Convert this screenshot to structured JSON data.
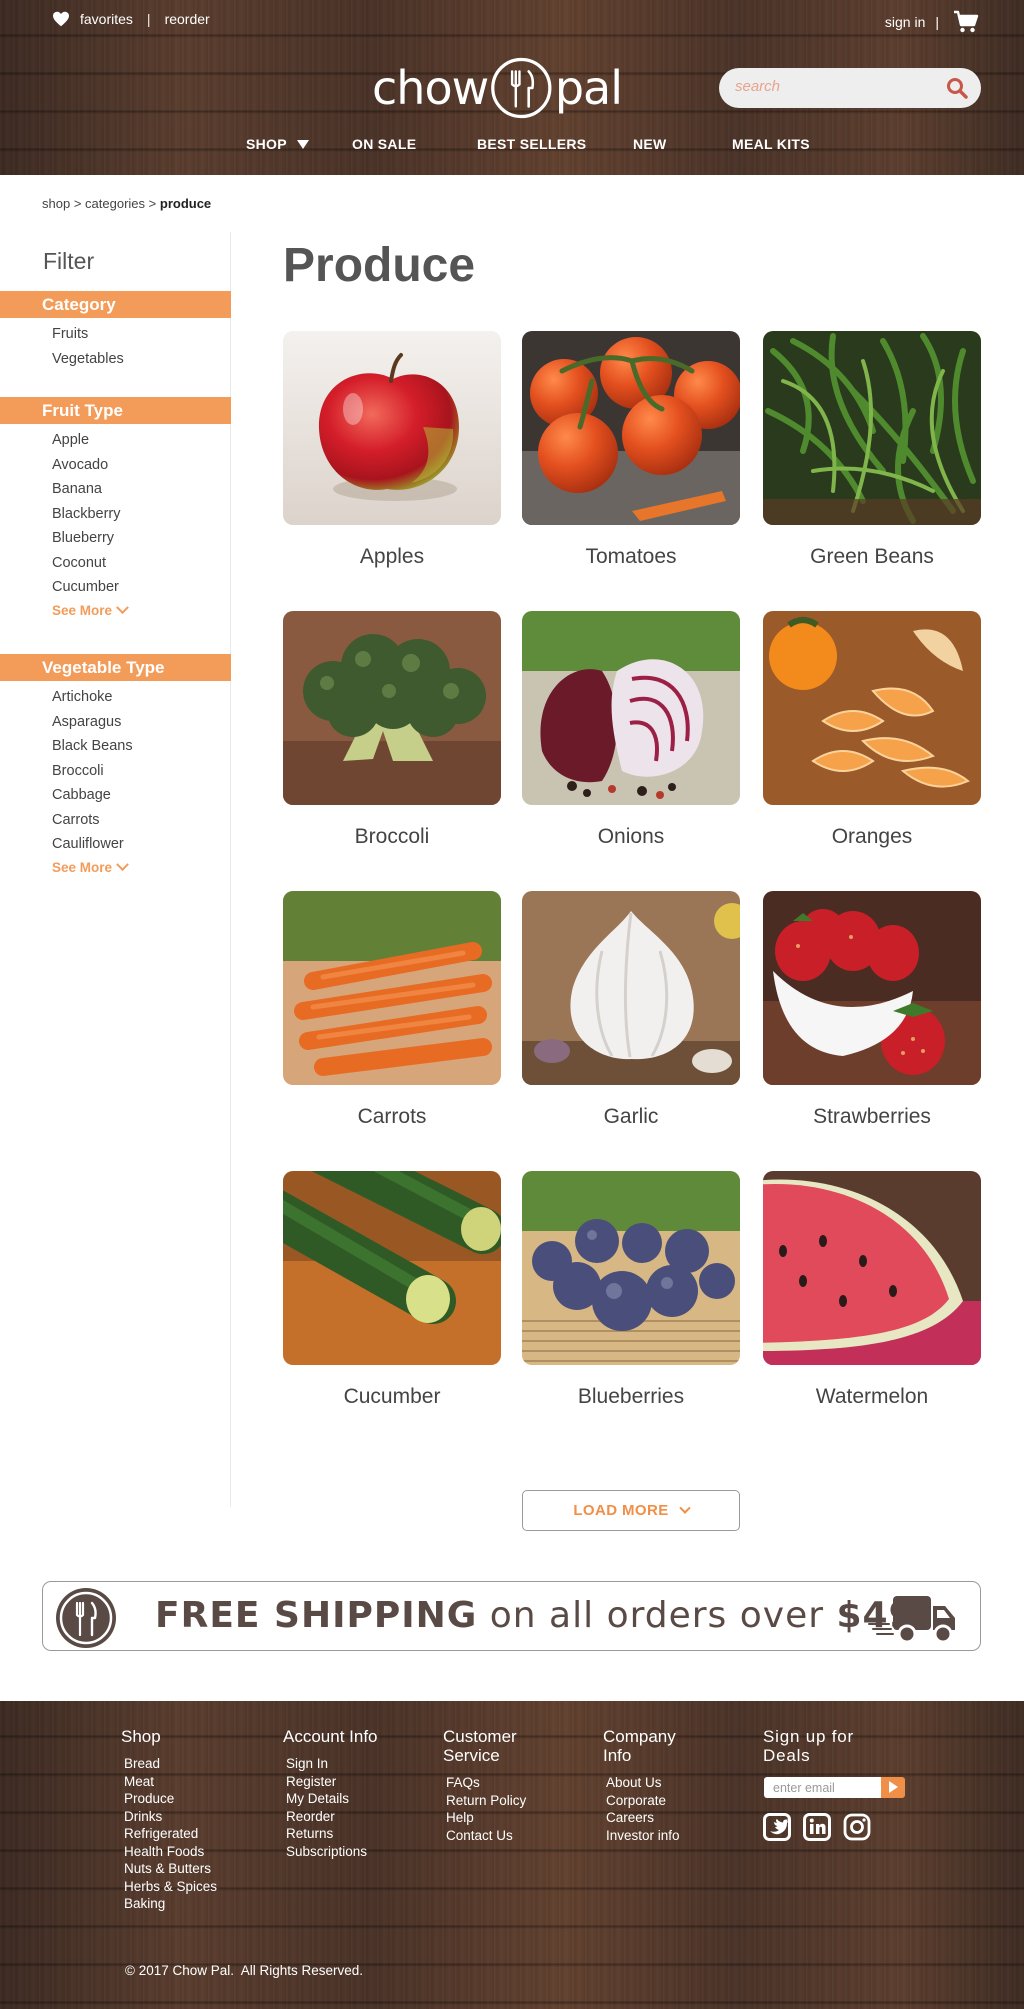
{
  "header": {
    "favorites": "favorites",
    "reorder": "reorder",
    "sign_in": "sign in",
    "logo_left": "chow",
    "logo_right": "pal",
    "search_placeholder": "search",
    "nav": [
      "SHOP",
      "ON SALE",
      "BEST SELLERS",
      "NEW",
      "MEAL KITS"
    ]
  },
  "breadcrumb": {
    "shop": "shop",
    "sep1": ">",
    "categories": "categories",
    "sep2": ">",
    "current": "produce"
  },
  "sidebar": {
    "title": "Filter",
    "category": {
      "heading": "Category",
      "items": [
        "Fruits",
        "Vegetables"
      ]
    },
    "fruit_type": {
      "heading": "Fruit Type",
      "items": [
        "Apple",
        "Avocado",
        "Banana",
        "Blackberry",
        "Blueberry",
        "Coconut",
        "Cucumber"
      ],
      "see_more": "See More"
    },
    "vegetable_type": {
      "heading": "Vegetable Type",
      "items": [
        "Artichoke",
        "Asparagus",
        "Black Beans",
        "Broccoli",
        "Cabbage",
        "Carrots",
        "Cauliflower"
      ],
      "see_more": "See More"
    }
  },
  "main": {
    "title": "Produce",
    "products": [
      "Apples",
      "Tomatoes",
      "Green Beans",
      "Broccoli",
      "Onions",
      "Oranges",
      "Carrots",
      "Garlic",
      "Strawberries",
      "Cucumber",
      "Blueberries",
      "Watermelon"
    ],
    "load_more": "LOAD MORE"
  },
  "banner": {
    "free_shipping": "FREE SHIPPING",
    "on_all_orders": " on all orders over ",
    "amount": "$49"
  },
  "footer": {
    "shop": {
      "heading": "Shop",
      "items": [
        "Bread",
        "Meat",
        "Produce",
        "Drinks",
        "Refrigerated",
        "Health Foods",
        "Nuts & Butters",
        "Herbs & Spices",
        "Baking"
      ]
    },
    "account": {
      "heading": "Account Info",
      "items": [
        "Sign In",
        "Register",
        "My Details",
        "Reorder",
        "Returns",
        "Subscriptions"
      ]
    },
    "service": {
      "heading": "Customer Service",
      "items": [
        "FAQs",
        "Return Policy",
        "Help",
        "Contact Us"
      ]
    },
    "company": {
      "heading": "Company Info",
      "items": [
        "About Us",
        "Corporate",
        "Careers",
        "Investor info"
      ]
    },
    "deals": {
      "heading": "Sign up for Deals",
      "email_placeholder": "enter email"
    },
    "social_icons": [
      "twitter-icon",
      "linkedin-icon",
      "instagram-icon"
    ],
    "copyright": "© 2017 Chow Pal.  All Rights Reserved."
  },
  "colors": {
    "accent": "#f39c5a",
    "text": "#4a4a4a",
    "wood": "#4a3328"
  }
}
